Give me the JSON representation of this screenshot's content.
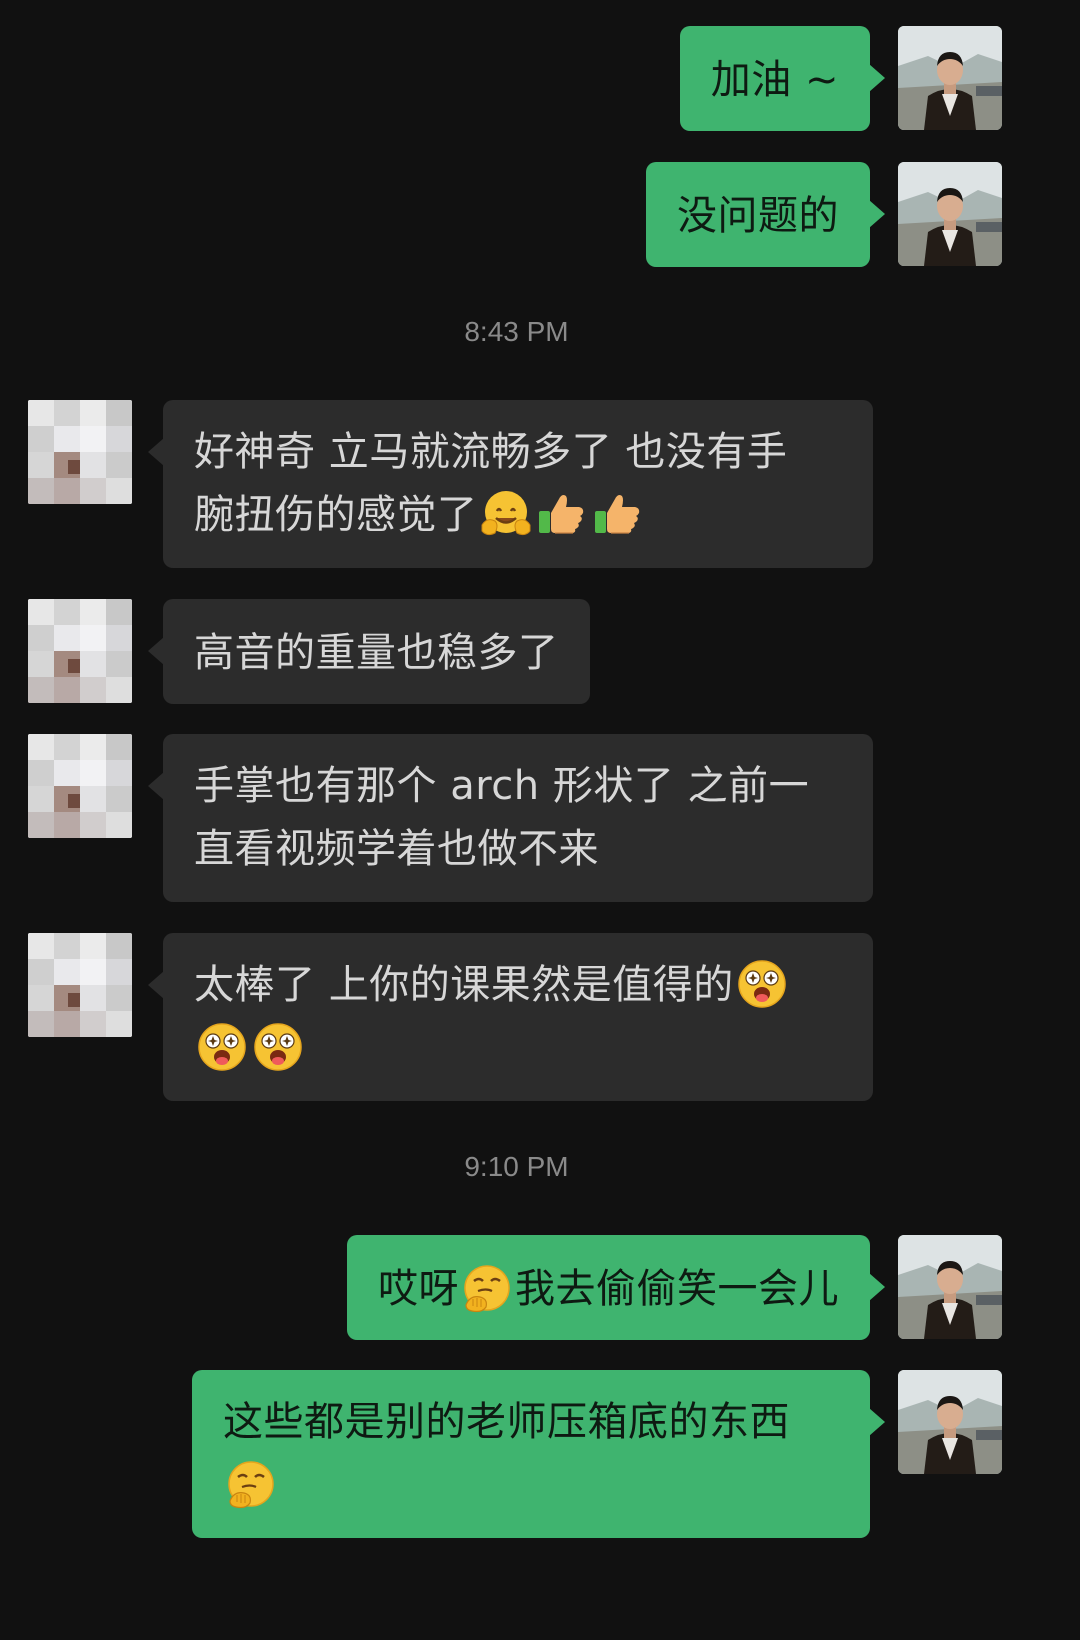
{
  "conversation": {
    "messages": [
      {
        "id": "m1",
        "direction": "outgoing",
        "text": "加油 ~"
      },
      {
        "id": "m2",
        "direction": "outgoing",
        "text": "没问题的"
      },
      {
        "id": "t1",
        "type": "timestamp",
        "text": "8:43 PM"
      },
      {
        "id": "m3",
        "direction": "incoming",
        "text_line1": "好神奇 立马就流畅多了 也没有手",
        "text_line2": "腕扭伤的感觉了",
        "emojis": [
          "hugging-face",
          "thumbs-up",
          "thumbs-up"
        ]
      },
      {
        "id": "m4",
        "direction": "incoming",
        "text": "高音的重量也稳多了"
      },
      {
        "id": "m5",
        "direction": "incoming",
        "text_line1": "手掌也有那个 arch 形状了 之前一",
        "text_line2": "直看视频学着也做不来"
      },
      {
        "id": "m6",
        "direction": "incoming",
        "text": "太棒了 上你的课果然是值得的",
        "emojis": [
          "star-struck-tongue",
          "star-struck-tongue",
          "star-struck-tongue"
        ]
      },
      {
        "id": "t2",
        "type": "timestamp",
        "text": "9:10 PM"
      },
      {
        "id": "m7",
        "direction": "outgoing",
        "text_before": "哎呀",
        "text_after": "我去偷偷笑一会儿",
        "emojis": [
          "snickering-face"
        ]
      },
      {
        "id": "m8",
        "direction": "outgoing",
        "text": "这些都是别的老师压箱底的东西",
        "emojis": [
          "snickering-face"
        ]
      }
    ]
  },
  "colors": {
    "background": "#111111",
    "outgoing_bubble": "#3fb46f",
    "incoming_bubble": "#2c2c2c",
    "incoming_text": "#d7d7d7",
    "timestamp_text": "#8a8a8a"
  }
}
